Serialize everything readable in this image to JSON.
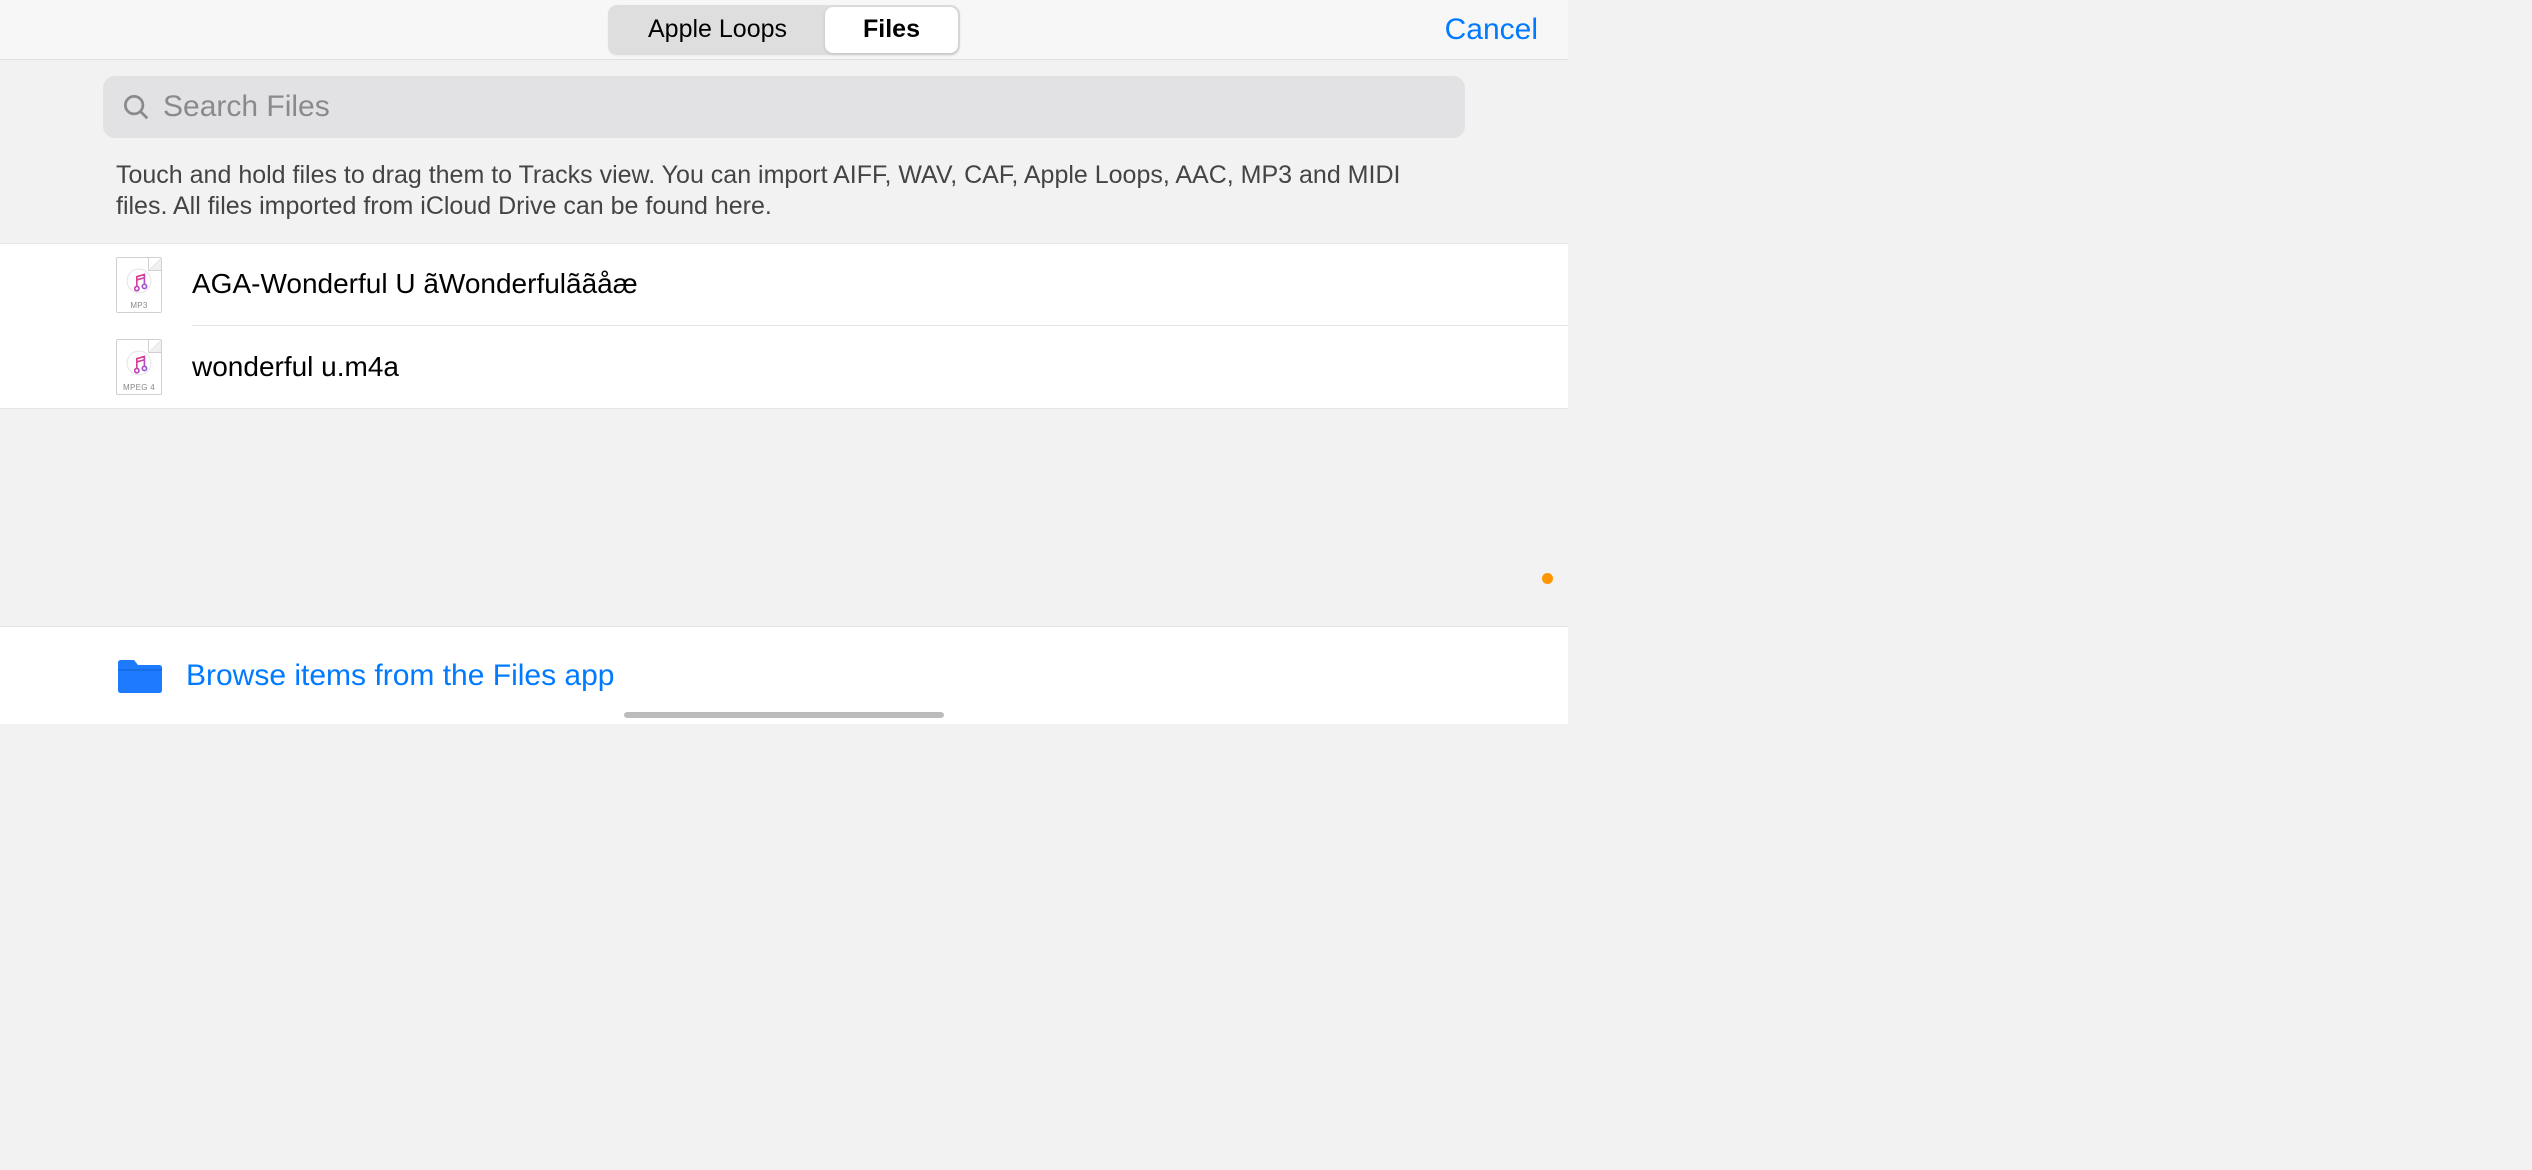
{
  "header": {
    "tabs": [
      {
        "label": "Apple Loops",
        "active": false
      },
      {
        "label": "Files",
        "active": true
      }
    ],
    "cancel_label": "Cancel"
  },
  "search": {
    "placeholder": "Search Files"
  },
  "help_text": "Touch and hold files to drag them to Tracks view. You can import AIFF, WAV, CAF, Apple Loops, AAC, MP3 and MIDI files. All files imported from iCloud Drive can be found here.",
  "files": [
    {
      "name": "AGA-Wonderful U ãWonderfulããåæ",
      "type_label": "MP3"
    },
    {
      "name": "wonderful u.m4a",
      "type_label": "MPEG 4"
    }
  ],
  "footer": {
    "browse_label": "Browse items from the Files app"
  }
}
